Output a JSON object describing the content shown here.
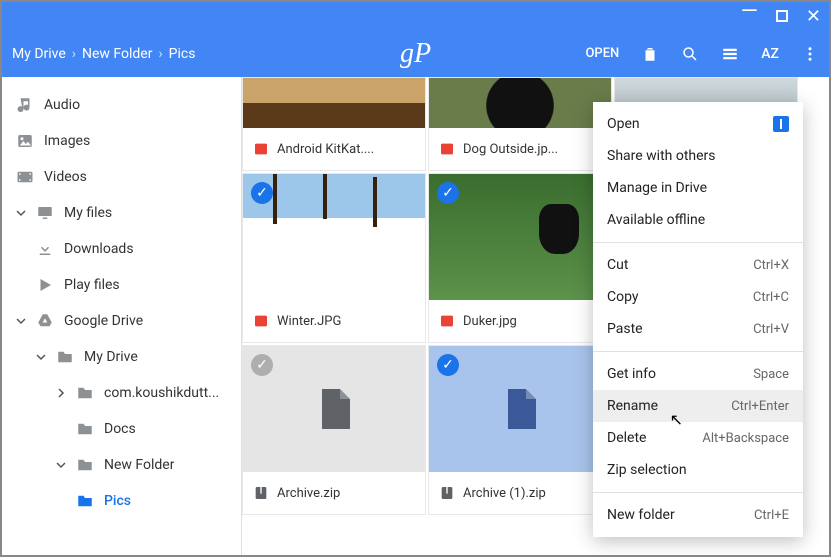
{
  "breadcrumb": [
    "My Drive",
    "New Folder",
    "Pics"
  ],
  "logo": "gP",
  "toolbar": {
    "open": "OPEN"
  },
  "sidebar": {
    "items": [
      {
        "label": "Audio",
        "icon": "music"
      },
      {
        "label": "Images",
        "icon": "image"
      },
      {
        "label": "Videos",
        "icon": "video"
      }
    ],
    "myfiles": {
      "label": "My files",
      "children": [
        {
          "label": "Downloads",
          "icon": "download"
        },
        {
          "label": "Play files",
          "icon": "play"
        }
      ]
    },
    "gdrive": {
      "label": "Google Drive",
      "mydrive": {
        "label": "My Drive",
        "children": [
          {
            "label": "com.koushikdutt..."
          },
          {
            "label": "Docs"
          },
          {
            "label": "New Folder",
            "expandable": true,
            "children": [
              {
                "label": "Pics",
                "active": true
              }
            ]
          }
        ]
      }
    }
  },
  "files": [
    {
      "name": "Android KitKat....",
      "type": "image",
      "thumb": "kitkat",
      "selected": false
    },
    {
      "name": "Dog Outside.jp...",
      "type": "image",
      "thumb": "dog",
      "selected": false
    },
    {
      "name": "Winter.JPG",
      "type": "image",
      "thumb": "winter",
      "selected": true
    },
    {
      "name": "Duker.jpg",
      "type": "image",
      "thumb": "duker",
      "selected": true
    },
    {
      "name": "Archive.zip",
      "type": "zip",
      "thumb": "doc-grey",
      "selected": true
    },
    {
      "name": "Archive (1).zip",
      "type": "zip",
      "thumb": "doc-blue",
      "selected": true
    }
  ],
  "context_menu": {
    "highlighted": "Rename",
    "groups": [
      [
        {
          "label": "Open",
          "badge": true
        },
        {
          "label": "Share with others"
        },
        {
          "label": "Manage in Drive"
        },
        {
          "label": "Available offline"
        }
      ],
      [
        {
          "label": "Cut",
          "shortcut": "Ctrl+X"
        },
        {
          "label": "Copy",
          "shortcut": "Ctrl+C"
        },
        {
          "label": "Paste",
          "shortcut": "Ctrl+V"
        }
      ],
      [
        {
          "label": "Get info",
          "shortcut": "Space"
        },
        {
          "label": "Rename",
          "shortcut": "Ctrl+Enter"
        },
        {
          "label": "Delete",
          "shortcut": "Alt+Backspace"
        },
        {
          "label": "Zip selection"
        }
      ],
      [
        {
          "label": "New folder",
          "shortcut": "Ctrl+E"
        }
      ]
    ]
  }
}
